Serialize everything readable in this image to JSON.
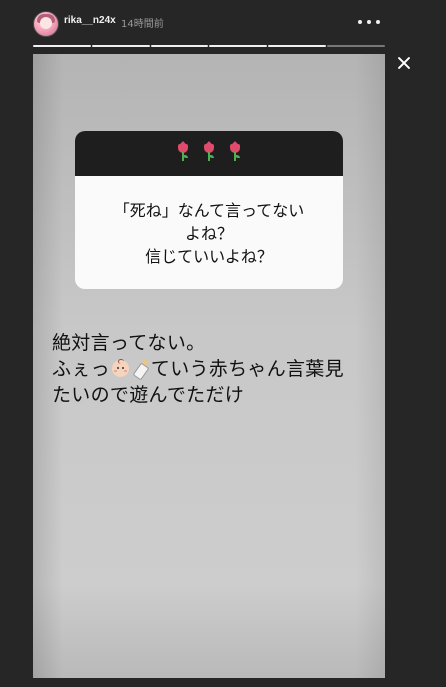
{
  "header": {
    "username": "rika__n24x",
    "time_ago": "14時間前",
    "avatar_icon": "profile-avatar",
    "more_icon": "more-horizontal-icon"
  },
  "progress": {
    "segments_total": 6,
    "segments_viewed": 5
  },
  "story": {
    "close_icon": "close-icon",
    "question_sticker": {
      "decoration": "🌷🌷🌷",
      "lines": [
        "「死ね」なんて言ってない",
        "よね？",
        "信じていいよね？"
      ]
    },
    "answer": {
      "line1": "絶対言ってない。",
      "line2_pre": "ふぇっ",
      "line2_emoji1": "baby-emoji",
      "line2_emoji2": "baby-bottle-emoji",
      "line2_post": "ていう赤ちゃん言葉見",
      "line3": "たいので遊んでただけ"
    }
  },
  "colors": {
    "background": "#262626",
    "story_gray": "#c8c8c8",
    "sticker_header": "#1e1e1e",
    "tulip": "#e04a6b"
  }
}
